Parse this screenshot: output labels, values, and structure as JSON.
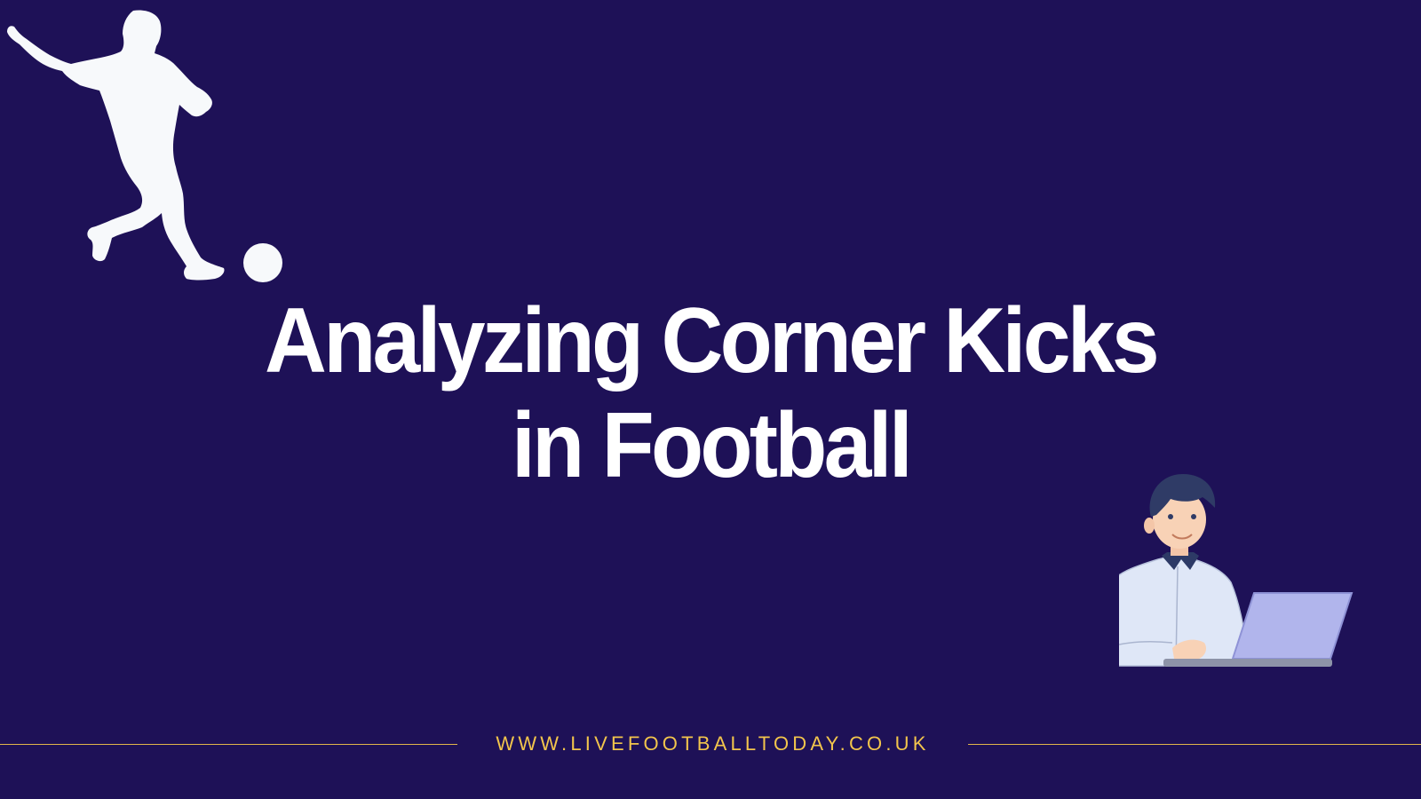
{
  "headline": {
    "line1": "Analyzing Corner Kicks",
    "line2": "in Football"
  },
  "footer": {
    "url": "WWW.LIVEFOOTBALLTODAY.CO.UK"
  },
  "colors": {
    "background": "#1e1157",
    "headline": "#ffffff",
    "accent": "#f2c54c"
  },
  "icons": {
    "player": "footballer-silhouette-icon",
    "ball": "football-icon",
    "analyst": "man-with-laptop-illustration"
  }
}
